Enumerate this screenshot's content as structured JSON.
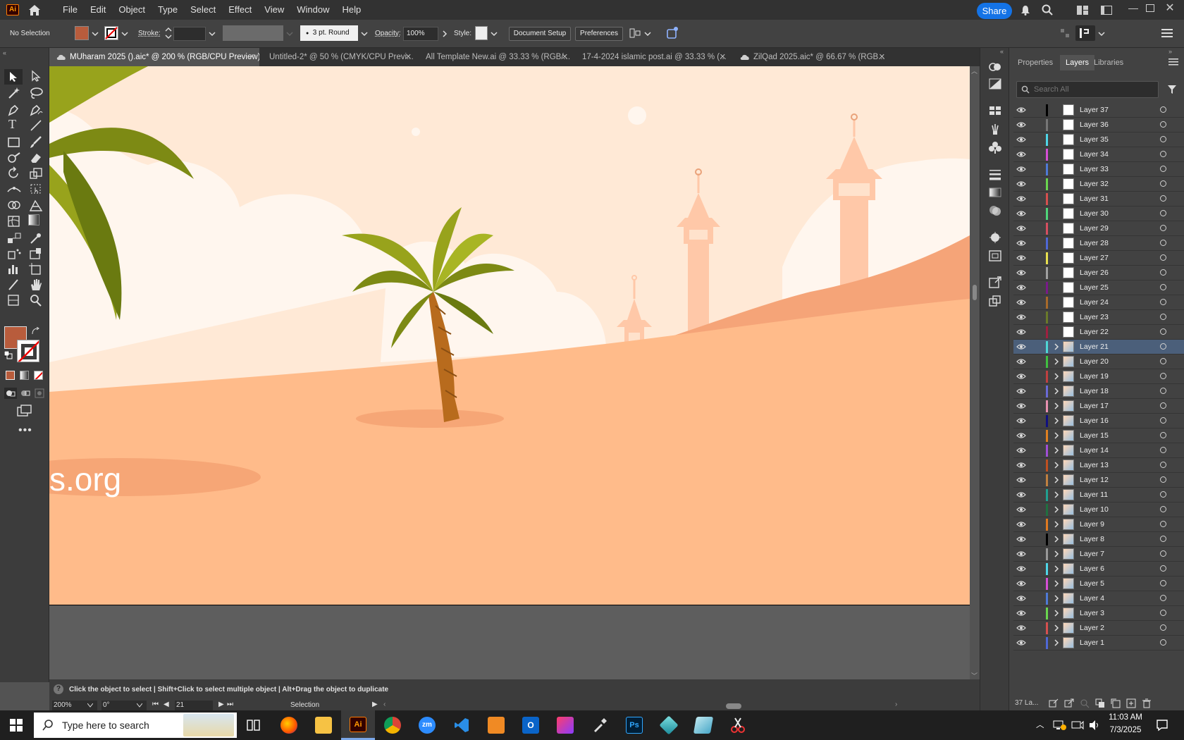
{
  "app": {
    "logo_text": "Ai"
  },
  "menus": [
    "File",
    "Edit",
    "Object",
    "Type",
    "Select",
    "Effect",
    "View",
    "Window",
    "Help"
  ],
  "share_label": "Share",
  "control": {
    "selection_label": "No Selection",
    "stroke_label": "Stroke:",
    "brush_value": "3 pt. Round",
    "opacity_label": "Opacity:",
    "opacity_value": "100%",
    "style_label": "Style:",
    "document_setup": "Document Setup",
    "preferences": "Preferences",
    "fill_color": "#b85c3c"
  },
  "tabs": [
    {
      "label": "MUharam 2025 ().aic* @ 200 % (RGB/CPU Preview)",
      "active": true
    },
    {
      "label": "Untitled-2* @ 50 % (CMYK/CPU Previ...",
      "active": false
    },
    {
      "label": "All Template New.ai @ 33.33 % (RGB/...",
      "active": false
    },
    {
      "label": "17-4-2024 islamic post.ai @ 33.33 % (...",
      "active": false
    },
    {
      "label": "ZilQad 2025.aic* @ 66.67 % (RGB...",
      "active": false
    }
  ],
  "artboard": {
    "text": "s.org",
    "sky_color": "#ffe9d6",
    "sand_color": "#ffbb8a"
  },
  "panel": {
    "tabs": [
      "Properties",
      "Layers",
      "Libraries"
    ],
    "active_tab": "Layers",
    "search_placeholder": "Search All",
    "footer_count": "37 La...",
    "layers": [
      {
        "name": "Layer 37",
        "color": "#000000",
        "expandable": false,
        "selected": false
      },
      {
        "name": "Layer 36",
        "color": "#777777",
        "expandable": false,
        "selected": false
      },
      {
        "name": "Layer 35",
        "color": "#4fd6e8",
        "expandable": false,
        "selected": false
      },
      {
        "name": "Layer 34",
        "color": "#d64fd6",
        "expandable": false,
        "selected": false
      },
      {
        "name": "Layer 33",
        "color": "#4f7ad6",
        "expandable": false,
        "selected": false
      },
      {
        "name": "Layer 32",
        "color": "#6ad64f",
        "expandable": false,
        "selected": false
      },
      {
        "name": "Layer 31",
        "color": "#d6504f",
        "expandable": false,
        "selected": false
      },
      {
        "name": "Layer 30",
        "color": "#4fd67a",
        "expandable": false,
        "selected": false
      },
      {
        "name": "Layer 29",
        "color": "#d64f60",
        "expandable": false,
        "selected": false
      },
      {
        "name": "Layer 28",
        "color": "#4f68d6",
        "expandable": false,
        "selected": false
      },
      {
        "name": "Layer 27",
        "color": "#e8e04f",
        "expandable": false,
        "selected": false
      },
      {
        "name": "Layer 26",
        "color": "#a0a0a0",
        "expandable": false,
        "selected": false
      },
      {
        "name": "Layer 25",
        "color": "#7a1a8a",
        "expandable": false,
        "selected": false
      },
      {
        "name": "Layer 24",
        "color": "#a86a2a",
        "expandable": false,
        "selected": false
      },
      {
        "name": "Layer 23",
        "color": "#6a7a2a",
        "expandable": false,
        "selected": false
      },
      {
        "name": "Layer 22",
        "color": "#a02040",
        "expandable": false,
        "selected": false
      },
      {
        "name": "Layer 21",
        "color": "#4fd6d6",
        "expandable": true,
        "selected": true
      },
      {
        "name": "Layer 20",
        "color": "#40c040",
        "expandable": true,
        "selected": false
      },
      {
        "name": "Layer 19",
        "color": "#c04040",
        "expandable": true,
        "selected": false
      },
      {
        "name": "Layer 18",
        "color": "#6a6ad6",
        "expandable": true,
        "selected": false
      },
      {
        "name": "Layer 17",
        "color": "#e890b0",
        "expandable": true,
        "selected": false
      },
      {
        "name": "Layer 16",
        "color": "#101080",
        "expandable": true,
        "selected": false
      },
      {
        "name": "Layer 15",
        "color": "#e08020",
        "expandable": true,
        "selected": false
      },
      {
        "name": "Layer 14",
        "color": "#a04fd6",
        "expandable": true,
        "selected": false
      },
      {
        "name": "Layer 13",
        "color": "#c05020",
        "expandable": true,
        "selected": false
      },
      {
        "name": "Layer 12",
        "color": "#c08040",
        "expandable": true,
        "selected": false
      },
      {
        "name": "Layer 11",
        "color": "#20a090",
        "expandable": true,
        "selected": false
      },
      {
        "name": "Layer 10",
        "color": "#207040",
        "expandable": true,
        "selected": false
      },
      {
        "name": "Layer 9",
        "color": "#e07a20",
        "expandable": true,
        "selected": false
      },
      {
        "name": "Layer 8",
        "color": "#000000",
        "expandable": true,
        "selected": false
      },
      {
        "name": "Layer 7",
        "color": "#999999",
        "expandable": true,
        "selected": false
      },
      {
        "name": "Layer 6",
        "color": "#4fd6e8",
        "expandable": true,
        "selected": false
      },
      {
        "name": "Layer 5",
        "color": "#d64fd6",
        "expandable": true,
        "selected": false
      },
      {
        "name": "Layer 4",
        "color": "#4f7ad6",
        "expandable": true,
        "selected": false
      },
      {
        "name": "Layer 3",
        "color": "#6ad64f",
        "expandable": true,
        "selected": false
      },
      {
        "name": "Layer 2",
        "color": "#d6504f",
        "expandable": true,
        "selected": false
      },
      {
        "name": "Layer 1",
        "color": "#4f68d6",
        "expandable": true,
        "selected": false
      }
    ]
  },
  "status": {
    "hint": "Click the object to select  |  Shift+Click to select multiple object  |  Alt+Drag the object to duplicate",
    "zoom": "200%",
    "rotation": "0°",
    "artboard_num": "21",
    "tool": "Selection"
  },
  "taskbar": {
    "search_placeholder": "Type here to search",
    "time": "11:03 AM",
    "date": "7/3/2025"
  }
}
